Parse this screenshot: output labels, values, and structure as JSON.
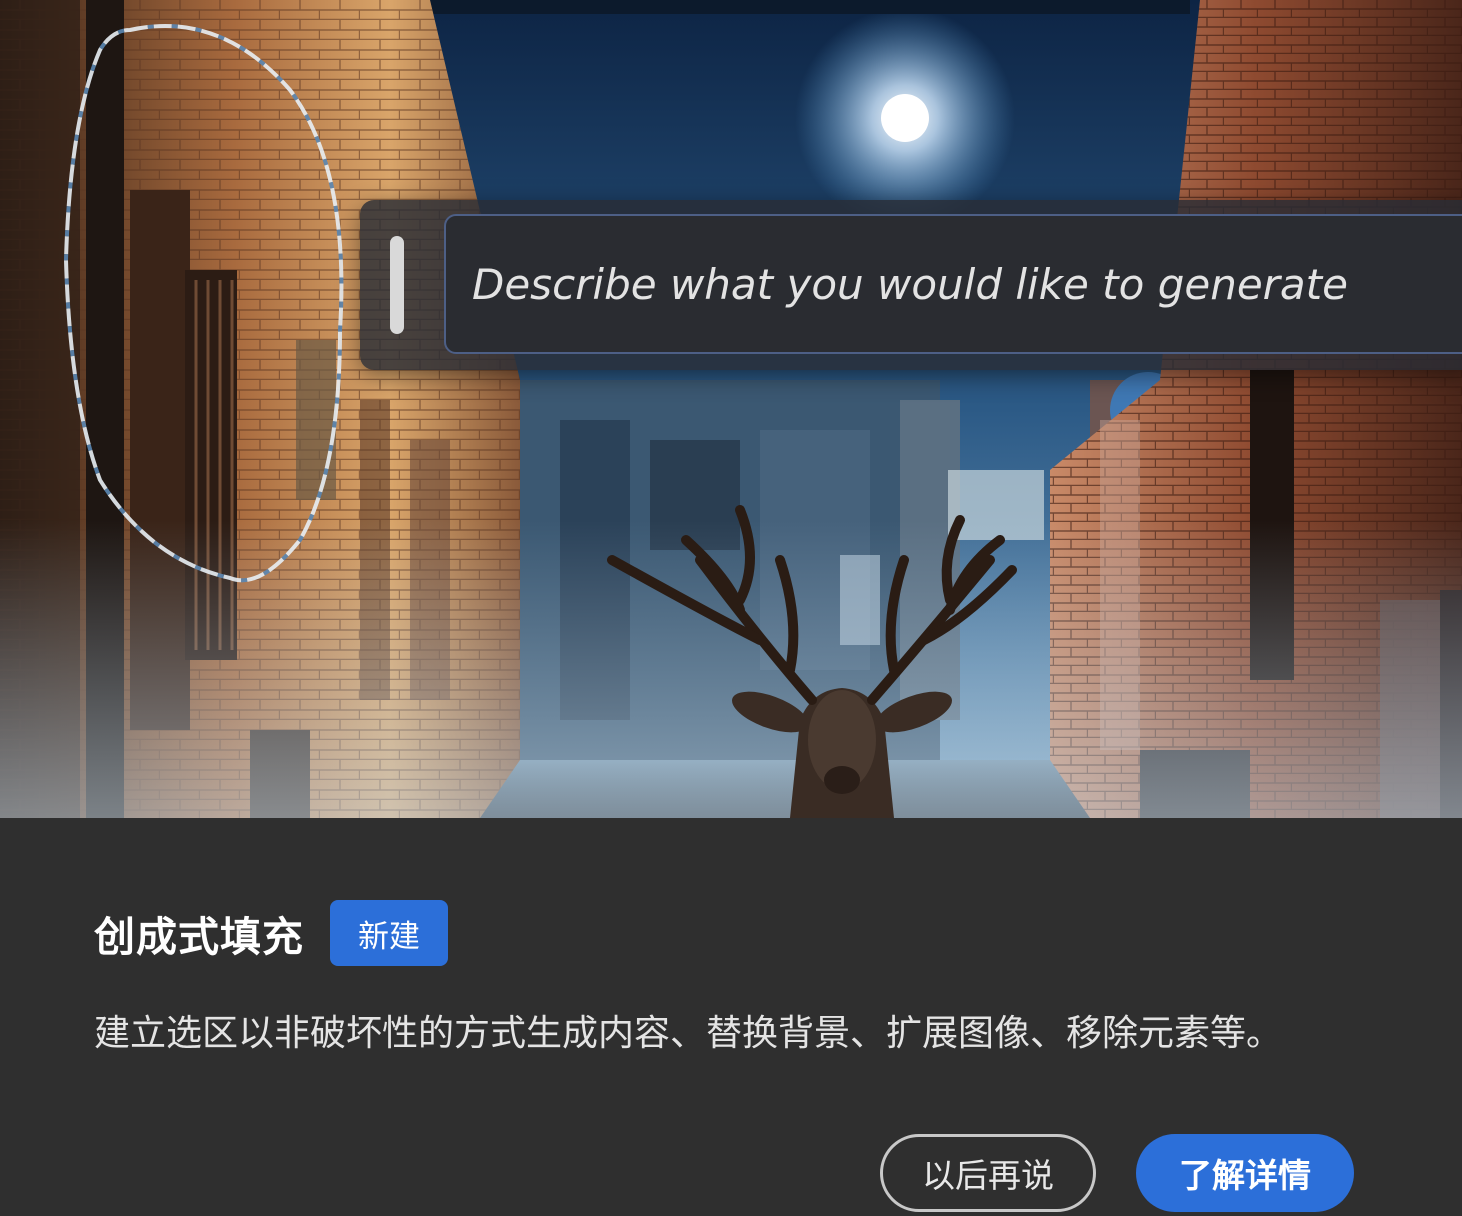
{
  "hero": {
    "prompt_placeholder": "Describe what you would like to generate"
  },
  "panel": {
    "title": "创成式填充",
    "badge": "新建",
    "description": "建立选区以非破坏性的方式生成内容、替换背景、扩展图像、移除元素等。",
    "buttons": {
      "later_label": "以后再说",
      "learn_label": "了解详情"
    }
  },
  "colors": {
    "accent": "#2c6fd9",
    "panel_bg": "#2f2f2f",
    "input_border": "#4d5f86"
  }
}
